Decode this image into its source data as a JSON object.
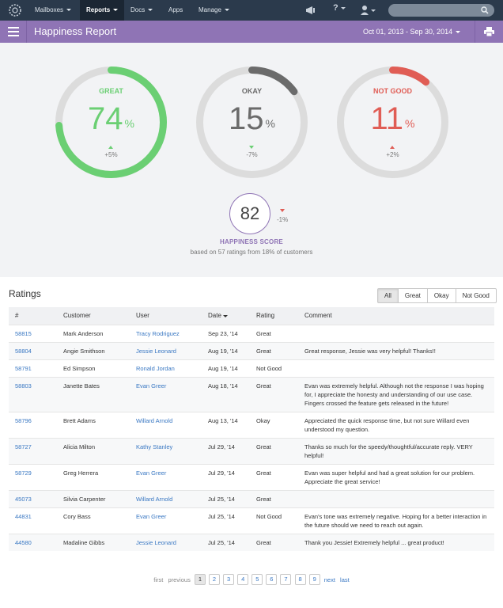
{
  "nav": {
    "items": [
      "Mailboxes",
      "Reports",
      "Docs",
      "Apps",
      "Manage"
    ],
    "active": "Reports"
  },
  "header": {
    "title": "Happiness Report",
    "date_range": "Oct 01, 2013 - Sep 30, 2014"
  },
  "gauges": [
    {
      "label": "GREAT",
      "value": "74",
      "unit": "%",
      "change": "+5%",
      "direction": "up",
      "fraction": 0.74,
      "color": "#6bcf73"
    },
    {
      "label": "OKAY",
      "value": "15",
      "unit": "%",
      "change": "-7%",
      "direction": "down",
      "fraction": 0.15,
      "color": "#6b6b6b"
    },
    {
      "label": "NOT GOOD",
      "value": "11",
      "unit": "%",
      "change": "+2%",
      "direction": "up",
      "fraction": 0.11,
      "color": "#e05d55"
    }
  ],
  "score": {
    "value": "82",
    "change": "-1%",
    "label": "HAPPINESS SCORE",
    "subtitle": "based on 57 ratings from 18% of customers"
  },
  "ratings": {
    "title": "Ratings",
    "filters": [
      "All",
      "Great",
      "Okay",
      "Not Good"
    ],
    "active_filter": "All",
    "columns": [
      "#",
      "Customer",
      "User",
      "Date",
      "Rating",
      "Comment"
    ],
    "rows": [
      {
        "id": "58815",
        "customer": "Mark Anderson",
        "user": "Tracy Rodriguez",
        "date": "Sep 23, '14",
        "rating": "Great",
        "comment": ""
      },
      {
        "id": "58804",
        "customer": "Angie Smithson",
        "user": "Jessie Leonard",
        "date": "Aug 19, '14",
        "rating": "Great",
        "comment": "Great response, Jessie was very helpful! Thanks!!"
      },
      {
        "id": "58791",
        "customer": "Ed Simpson",
        "user": "Ronald Jordan",
        "date": "Aug 19, '14",
        "rating": "Not Good",
        "comment": ""
      },
      {
        "id": "58803",
        "customer": "Janette Bates",
        "user": "Evan Greer",
        "date": "Aug 18, '14",
        "rating": "Great",
        "comment": "Evan was extremely helpful. Although not the response I was hoping for, I appreciate the honesty and understanding of our use case. Fingers crossed the feature gets released in the future!"
      },
      {
        "id": "58796",
        "customer": "Brett Adams",
        "user": "Willard Arnold",
        "date": "Aug 13, '14",
        "rating": "Okay",
        "comment": "Appreciated the quick response time, but not sure Willard even understood my question."
      },
      {
        "id": "58727",
        "customer": "Alicia Milton",
        "user": "Kathy Stanley",
        "date": "Jul 29, '14",
        "rating": "Great",
        "comment": "Thanks so much for the speedy/thoughtful/accurate reply. VERY helpful!"
      },
      {
        "id": "58729",
        "customer": "Greg Herrera",
        "user": "Evan Greer",
        "date": "Jul 29, '14",
        "rating": "Great",
        "comment": "Evan was super helpful and had a great solution for our problem. Appreciate the great service!"
      },
      {
        "id": "45073",
        "customer": "Silvia Carpenter",
        "user": "Willard Arnold",
        "date": "Jul 25, '14",
        "rating": "Great",
        "comment": ""
      },
      {
        "id": "44831",
        "customer": "Cory Bass",
        "user": "Evan Greer",
        "date": "Jul 25, '14",
        "rating": "Not Good",
        "comment": "Evan's tone was extremely negative. Hoping for a better interaction in the future should we need to reach out again."
      },
      {
        "id": "44580",
        "customer": "Madaline Gibbs",
        "user": "Jessie Leonard",
        "date": "Jul 25, '14",
        "rating": "Great",
        "comment": "Thank you Jessie! Extremely helpful ... great product!"
      }
    ]
  },
  "pagination": {
    "first": "first",
    "previous": "previous",
    "pages": [
      "1",
      "2",
      "3",
      "4",
      "5",
      "6",
      "7",
      "8",
      "9"
    ],
    "current": "1",
    "next": "next",
    "last": "last"
  },
  "colors": {
    "nav_bg": "#2b3a4c",
    "header_bg": "#8f74b5",
    "great": "#6bcf73",
    "okay": "#6b6b6b",
    "not_good": "#e05d55",
    "link": "#3a78c3"
  }
}
